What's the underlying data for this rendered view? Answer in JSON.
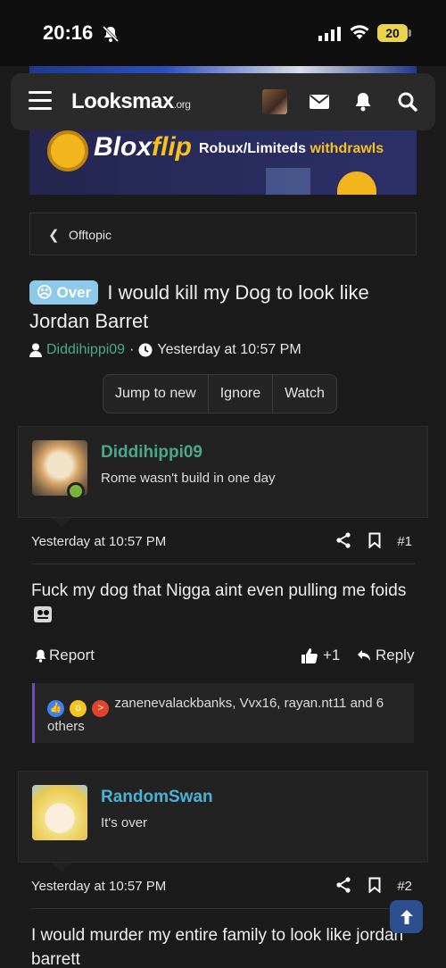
{
  "status_bar": {
    "time": "20:16",
    "battery": "20"
  },
  "header": {
    "logo_main": "Looksmax",
    "logo_tld": ".org"
  },
  "banner": {
    "brand_a": "Blox",
    "brand_b": "flip",
    "text_a": "Robux/Limiteds ",
    "text_b": "withdrawls"
  },
  "breadcrumb": {
    "label": "Offtopic"
  },
  "thread": {
    "prefix": "Over",
    "title": "I would kill my Dog to look like Jordan Barret",
    "author": "Diddihippi09",
    "separator": "·",
    "time": "Yesterday at 10:57 PM",
    "buttons": {
      "jump": "Jump to new",
      "ignore": "Ignore",
      "watch": "Watch"
    }
  },
  "posts": [
    {
      "user": "Diddihippi09",
      "user_color": "#49a98b",
      "user_title": "Rome wasn't build in one day",
      "time": "Yesterday at 10:57 PM",
      "number": "#1",
      "body": "Fuck my dog that Nigga aint even pulling me foids",
      "actions": {
        "report": "Report",
        "likes": "+1",
        "reply": "Reply"
      },
      "reactions_text": "zanenevalackbanks, Vvx16, rayan.nt11 and 6 others"
    },
    {
      "user": "RandomSwan",
      "user_color": "#4ab1d6",
      "user_title": "It's over",
      "time": "Yesterday at 10:57 PM",
      "number": "#2",
      "body": "I would murder my entire family to look like jordan barrett"
    }
  ]
}
